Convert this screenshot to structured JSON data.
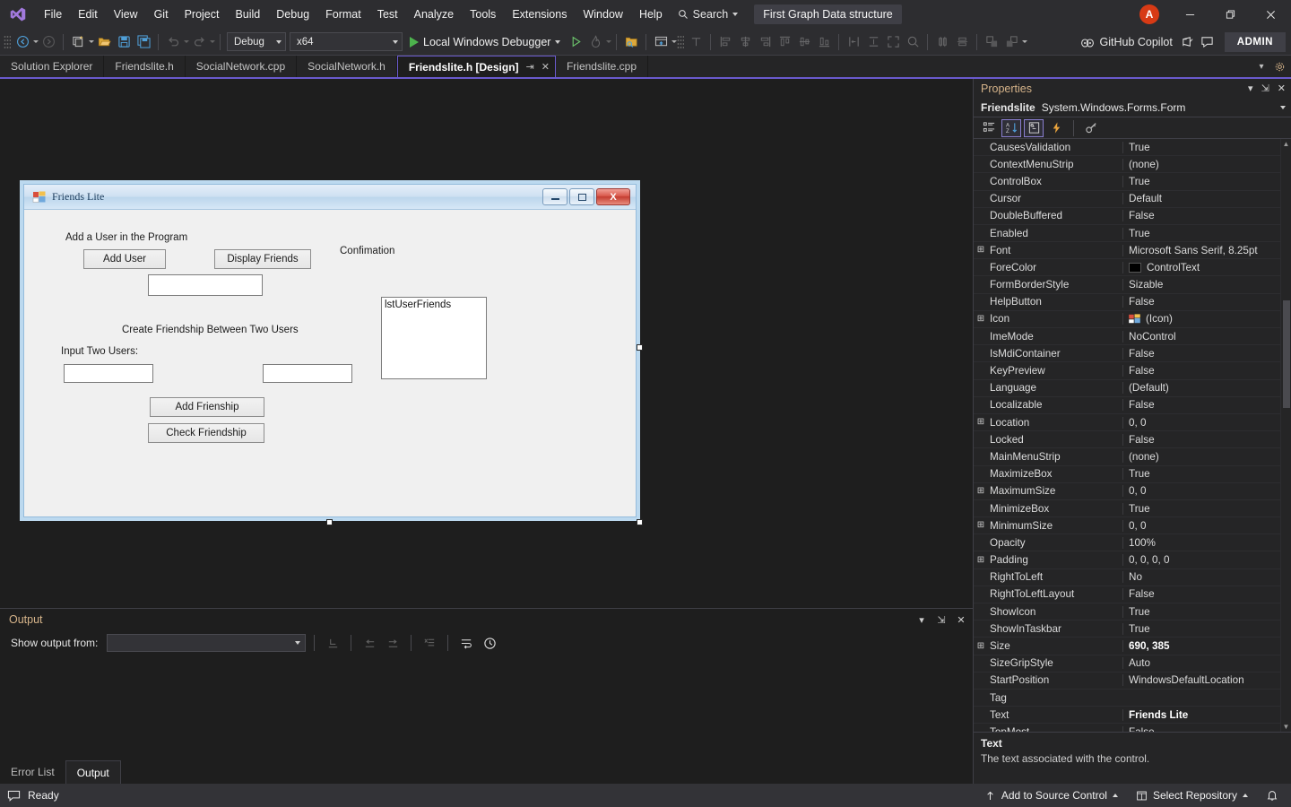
{
  "titlebar": {
    "logo_icon": "visual-studio-logo",
    "menu": [
      "File",
      "Edit",
      "View",
      "Git",
      "Project",
      "Build",
      "Debug",
      "Format",
      "Test",
      "Analyze",
      "Tools",
      "Extensions",
      "Window",
      "Help"
    ],
    "search_label": "Search",
    "search_icon": "magnifier-icon",
    "solution_chip": "First Graph Data structure",
    "avatar_initial": "A",
    "minimize_icon": "minimize-icon",
    "restore_icon": "restore-icon",
    "close_icon": "close-icon"
  },
  "toolbar": {
    "navigate_back_icon": "navigate-back-icon",
    "navigate_forward_icon": "navigate-forward-icon",
    "new_project_icon": "new-project-icon",
    "open_file_icon": "open-file-icon",
    "save_icon": "save-icon",
    "save_all_icon": "save-all-icon",
    "undo_icon": "undo-icon",
    "redo_icon": "redo-icon",
    "config_value": "Debug",
    "platform_value": "x64",
    "run_label": "Local Windows Debugger",
    "run_icon": "play-icon",
    "start_no_debug_icon": "play-outline-icon",
    "hot_reload_icon": "hot-reload-icon",
    "copilot_label": "GitHub Copilot",
    "copilot_icon": "copilot-icon",
    "share_icon": "share-icon",
    "feedback_icon": "feedback-icon",
    "admin_label": "ADMIN"
  },
  "tabs": {
    "items": [
      {
        "label": "Solution Explorer",
        "active": false
      },
      {
        "label": "Friendslite.h",
        "active": false
      },
      {
        "label": "SocialNetwork.cpp",
        "active": false
      },
      {
        "label": "SocialNetwork.h",
        "active": false
      },
      {
        "label": "Friendslite.h [Design]",
        "active": true
      },
      {
        "label": "Friendslite.cpp",
        "active": false
      }
    ],
    "pin_icon": "pin-icon",
    "close_icon": "close-icon",
    "overflow_icon": "chevron-down-icon",
    "settings_icon": "gear-icon"
  },
  "designer": {
    "form": {
      "title": "Friends Lite",
      "icon": "windows-form-icon",
      "minimize_icon": "minimize-icon",
      "maximize_icon": "maximize-icon",
      "close_label": "X",
      "controls": {
        "label_add_user_section": "Add a User in the Program",
        "button_add_user": "Add User",
        "button_display_friends": "Display Friends",
        "label_confirmation": "Confimation",
        "textbox_username": "",
        "label_create_friendship": "Create Friendship Between Two Users",
        "label_input_two_users": "Input Two Users:",
        "textbox_user_one": "",
        "textbox_user_two": "",
        "button_add_friendship": "Add Frienship",
        "button_check_friendship": "Check Friendship",
        "listbox_user_friends": "lstUserFriends"
      }
    }
  },
  "output": {
    "title": "Output",
    "show_output_from_label": "Show output from:",
    "show_output_from_value": "",
    "dropdown_icon": "chevron-down-icon",
    "collapse_icon": "chevron-down-icon",
    "pin_icon": "pin-icon",
    "close_icon": "close-icon",
    "toolbar_icons": [
      "go-to-message-icon",
      "previous-message-icon",
      "next-message-icon",
      "clear-all-icon",
      "toggle-word-wrap-icon",
      "show-timestamps-icon"
    ],
    "tabs": [
      {
        "label": "Error List",
        "active": false
      },
      {
        "label": "Output",
        "active": true
      }
    ]
  },
  "properties": {
    "title": "Properties",
    "collapse_icon": "chevron-down-icon",
    "pin_icon": "pin-icon",
    "close_icon": "close-icon",
    "object_name": "Friendslite",
    "object_type": "System.Windows.Forms.Form",
    "object_dropdown_icon": "chevron-down-icon",
    "toolbar": [
      {
        "name": "categorized-icon",
        "selected": false
      },
      {
        "name": "alphabetical-sort-icon",
        "selected": true
      },
      {
        "name": "properties-icon",
        "selected": true
      },
      {
        "name": "events-icon",
        "selected": false
      },
      {
        "name": "property-pages-icon",
        "selected": false
      }
    ],
    "rows": [
      {
        "name": "CausesValidation",
        "value": "True",
        "expandable": false,
        "bold": false
      },
      {
        "name": "ContextMenuStrip",
        "value": "(none)",
        "expandable": false,
        "bold": false
      },
      {
        "name": "ControlBox",
        "value": "True",
        "expandable": false,
        "bold": false
      },
      {
        "name": "Cursor",
        "value": "Default",
        "expandable": false,
        "bold": false
      },
      {
        "name": "DoubleBuffered",
        "value": "False",
        "expandable": false,
        "bold": false
      },
      {
        "name": "Enabled",
        "value": "True",
        "expandable": false,
        "bold": false
      },
      {
        "name": "Font",
        "value": "Microsoft Sans Serif, 8.25pt",
        "expandable": true,
        "bold": false
      },
      {
        "name": "ForeColor",
        "value": "ControlText",
        "expandable": false,
        "bold": false,
        "swatch": "#000000"
      },
      {
        "name": "FormBorderStyle",
        "value": "Sizable",
        "expandable": false,
        "bold": false
      },
      {
        "name": "HelpButton",
        "value": "False",
        "expandable": false,
        "bold": false
      },
      {
        "name": "Icon",
        "value": "(Icon)",
        "expandable": true,
        "bold": false,
        "icon": "form-icon-preview"
      },
      {
        "name": "ImeMode",
        "value": "NoControl",
        "expandable": false,
        "bold": false
      },
      {
        "name": "IsMdiContainer",
        "value": "False",
        "expandable": false,
        "bold": false
      },
      {
        "name": "KeyPreview",
        "value": "False",
        "expandable": false,
        "bold": false
      },
      {
        "name": "Language",
        "value": "(Default)",
        "expandable": false,
        "bold": false
      },
      {
        "name": "Localizable",
        "value": "False",
        "expandable": false,
        "bold": false
      },
      {
        "name": "Location",
        "value": "0, 0",
        "expandable": true,
        "bold": false
      },
      {
        "name": "Locked",
        "value": "False",
        "expandable": false,
        "bold": false
      },
      {
        "name": "MainMenuStrip",
        "value": "(none)",
        "expandable": false,
        "bold": false
      },
      {
        "name": "MaximizeBox",
        "value": "True",
        "expandable": false,
        "bold": false
      },
      {
        "name": "MaximumSize",
        "value": "0, 0",
        "expandable": true,
        "bold": false
      },
      {
        "name": "MinimizeBox",
        "value": "True",
        "expandable": false,
        "bold": false
      },
      {
        "name": "MinimumSize",
        "value": "0, 0",
        "expandable": true,
        "bold": false
      },
      {
        "name": "Opacity",
        "value": "100%",
        "expandable": false,
        "bold": false
      },
      {
        "name": "Padding",
        "value": "0, 0, 0, 0",
        "expandable": true,
        "bold": false
      },
      {
        "name": "RightToLeft",
        "value": "No",
        "expandable": false,
        "bold": false
      },
      {
        "name": "RightToLeftLayout",
        "value": "False",
        "expandable": false,
        "bold": false
      },
      {
        "name": "ShowIcon",
        "value": "True",
        "expandable": false,
        "bold": false
      },
      {
        "name": "ShowInTaskbar",
        "value": "True",
        "expandable": false,
        "bold": false
      },
      {
        "name": "Size",
        "value": "690, 385",
        "expandable": true,
        "bold": true
      },
      {
        "name": "SizeGripStyle",
        "value": "Auto",
        "expandable": false,
        "bold": false
      },
      {
        "name": "StartPosition",
        "value": "WindowsDefaultLocation",
        "expandable": false,
        "bold": false
      },
      {
        "name": "Tag",
        "value": "",
        "expandable": false,
        "bold": false
      },
      {
        "name": "Text",
        "value": "Friends Lite",
        "expandable": false,
        "bold": true
      },
      {
        "name": "TopMost",
        "value": "False",
        "expandable": false,
        "bold": false
      }
    ],
    "description_title": "Text",
    "description_body": "The text associated with the control."
  },
  "statusbar": {
    "ready_label": "Ready",
    "ready_icon": "speech-bubble-icon",
    "add_to_source_control": "Add to Source Control",
    "add_to_source_control_icon": "upload-arrow-icon",
    "select_repository": "Select Repository",
    "select_repository_icon": "repository-icon",
    "notifications_icon": "bell-icon"
  },
  "colors": {
    "accent_purple": "#6a5acd",
    "chrome_bg": "#2d2d30",
    "editor_bg": "#1e1e1e",
    "panel_bg": "#252526",
    "avatar_red": "#d73a15",
    "run_green": "#4db34d",
    "header_orange": "#d6b48a"
  }
}
